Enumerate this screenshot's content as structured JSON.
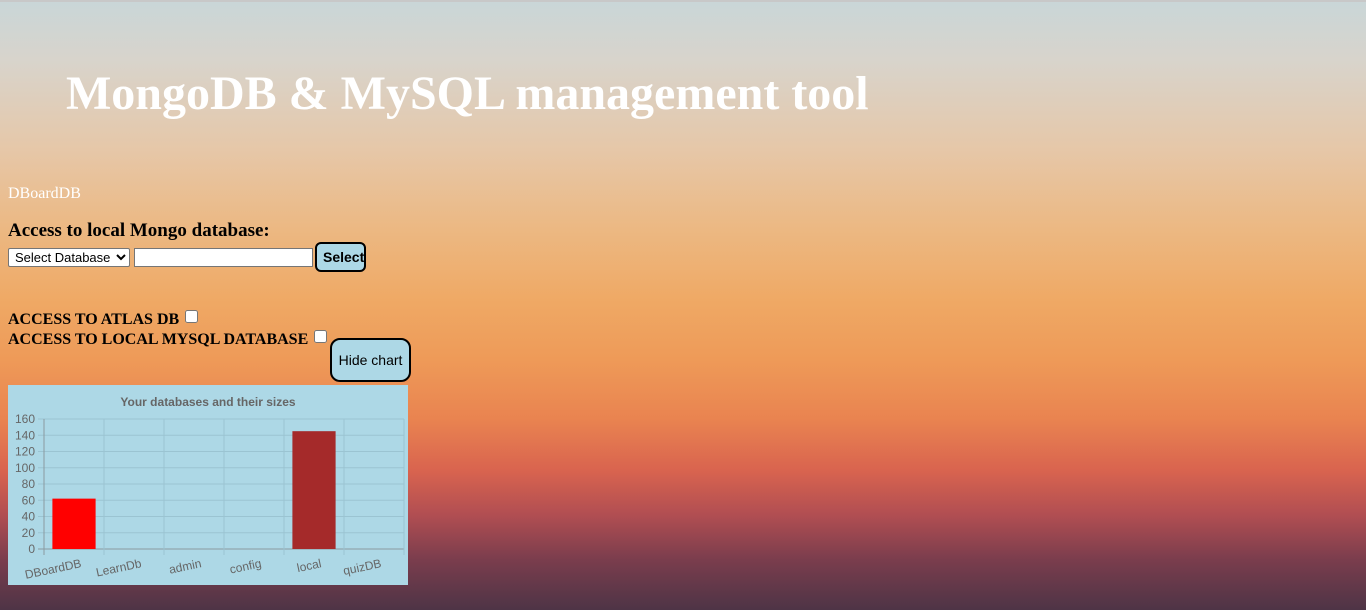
{
  "header": {
    "title": "MongoDB & MySQL management tool"
  },
  "nav": {
    "brand": "DBoardDB"
  },
  "mongo_access": {
    "label": "Access to local Mongo database:",
    "select_value": "Select Database",
    "input_value": "",
    "select_button": "Select"
  },
  "atlas": {
    "label": "ACCESS TO ATLAS DB",
    "checked": false
  },
  "mysql": {
    "label": "ACCESS TO LOCAL MYSQL DATABASE",
    "checked": false
  },
  "chart_toggle": {
    "label": "Hide chart"
  },
  "colors": {
    "button_bg": "#add8e6",
    "chart_bg": "#add8e6",
    "bar_dboarddb": "#ff0000",
    "bar_local": "#a52a2a"
  },
  "chart_data": {
    "type": "bar",
    "title": "Your databases and their sizes",
    "categories": [
      "DBoardDB",
      "LearnDb",
      "admin",
      "config",
      "local",
      "quizDB"
    ],
    "values": [
      62,
      0,
      0,
      0,
      145,
      0
    ],
    "bar_colors": [
      "#ff0000",
      "#ff0000",
      "#ff0000",
      "#ff0000",
      "#a52a2a",
      "#ff0000"
    ],
    "ylim": [
      0,
      160
    ],
    "yticks": [
      0,
      20,
      40,
      60,
      80,
      100,
      120,
      140,
      160
    ],
    "grid": true,
    "legend": "none"
  }
}
